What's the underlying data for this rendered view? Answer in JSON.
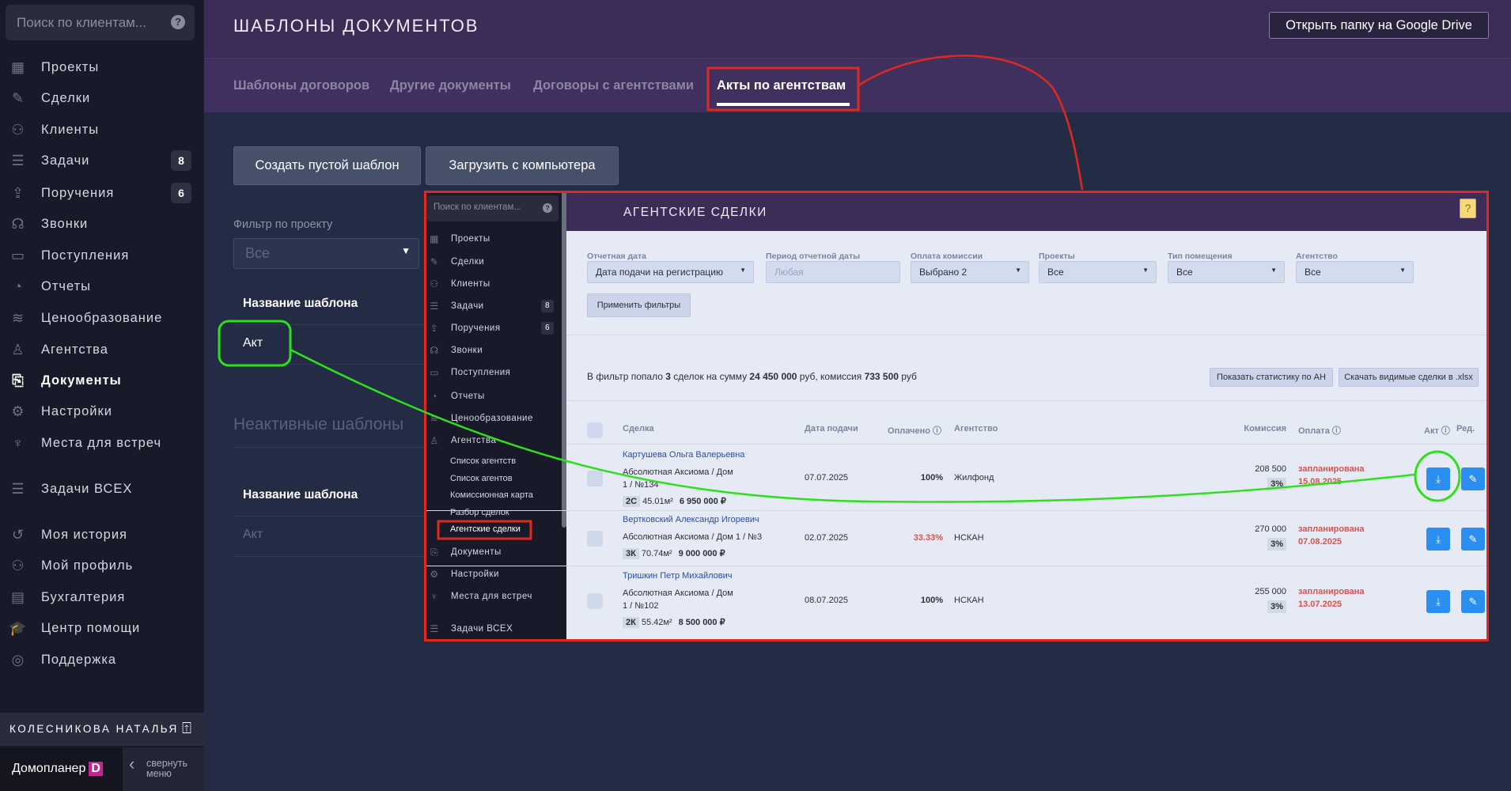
{
  "sidebar": {
    "search_placeholder": "Поиск по клиентам...",
    "items": [
      {
        "label": "Проекты",
        "icon": "building-icon",
        "glyph": "▦"
      },
      {
        "label": "Сделки",
        "icon": "deal-icon",
        "glyph": "✎"
      },
      {
        "label": "Клиенты",
        "icon": "users-icon",
        "glyph": "⚇"
      },
      {
        "label": "Задачи",
        "icon": "tasks-icon",
        "glyph": "☰",
        "badge": "8"
      },
      {
        "label": "Поручения",
        "icon": "inbox-upload-icon",
        "glyph": "⇪",
        "badge": "6"
      },
      {
        "label": "Звонки",
        "icon": "headset-icon",
        "glyph": "☊"
      },
      {
        "label": "Поступления",
        "icon": "wallet-icon",
        "glyph": "▭"
      },
      {
        "label": "Отчеты",
        "icon": "pie-chart-icon",
        "glyph": "◔"
      },
      {
        "label": "Ценообразование",
        "icon": "coins-icon",
        "glyph": "≋"
      },
      {
        "label": "Агентства",
        "icon": "agent-icon",
        "glyph": "♙"
      },
      {
        "label": "Документы",
        "icon": "documents-icon",
        "glyph": "⎘",
        "active": true
      },
      {
        "label": "Настройки",
        "icon": "gear-icon",
        "glyph": "⚙"
      },
      {
        "label": "Места для встреч",
        "icon": "microphone-icon",
        "glyph": "♆"
      },
      {
        "label": "Задачи ВСЕХ",
        "icon": "tasks-icon",
        "glyph": "☰"
      },
      {
        "label": "Моя история",
        "icon": "history-icon",
        "glyph": "↺"
      },
      {
        "label": "Мой профиль",
        "icon": "user-settings-icon",
        "glyph": "⚇"
      },
      {
        "label": "Бухгалтерия",
        "icon": "accounting-icon",
        "glyph": "▤"
      },
      {
        "label": "Центр помощи",
        "icon": "graduation-cap-icon",
        "glyph": "🎓"
      },
      {
        "label": "Поддержка",
        "icon": "lifebuoy-icon",
        "glyph": "◎"
      }
    ],
    "user_name": "КОЛЕСНИКОВА НАТАЛЬЯ",
    "brand": "Домопланер",
    "brand_logo": "D",
    "collapse_label_1": "свернуть",
    "collapse_label_2": "меню"
  },
  "header": {
    "title": "ШАБЛОНЫ ДОКУМЕНТОВ",
    "gdrive_button": "Открыть папку на Google Drive",
    "tabs": [
      {
        "label": "Шаблоны договоров"
      },
      {
        "label": "Другие документы"
      },
      {
        "label": "Договоры с агентствами"
      },
      {
        "label": "Акты по агентствам",
        "active": true
      }
    ]
  },
  "main": {
    "create_button": "Создать пустой шаблон",
    "upload_button": "Загрузить с компьютера",
    "filter_label": "Фильтр по проекту",
    "filter_value": "Все",
    "active_header": "Название шаблона",
    "active_templates": [
      "Акт"
    ],
    "inactive_title": "Неактивные шаблоны",
    "inactive_header": "Название шаблона",
    "inactive_templates": [
      "Акт"
    ]
  },
  "inner": {
    "search_placeholder": "Поиск по клиентам...",
    "nav": [
      {
        "label": "Проекты",
        "glyph": "▦",
        "icon": "building-icon"
      },
      {
        "label": "Сделки",
        "glyph": "✎",
        "icon": "deal-icon"
      },
      {
        "label": "Клиенты",
        "glyph": "⚇",
        "icon": "users-icon"
      },
      {
        "label": "Задачи",
        "glyph": "☰",
        "icon": "tasks-icon",
        "badge": "8"
      },
      {
        "label": "Поручения",
        "glyph": "⇪",
        "icon": "inbox-upload-icon",
        "badge": "6"
      },
      {
        "label": "Звонки",
        "glyph": "☊",
        "icon": "headset-icon"
      },
      {
        "label": "Поступления",
        "glyph": "▭",
        "icon": "wallet-icon"
      },
      {
        "label": "Отчеты",
        "glyph": "◔",
        "icon": "pie-chart-icon"
      },
      {
        "label": "Ценообразование",
        "glyph": "≋",
        "icon": "coins-icon"
      },
      {
        "label": "Агентства",
        "glyph": "♙",
        "icon": "agent-icon"
      },
      {
        "label": "Список агентств",
        "sub": true
      },
      {
        "label": "Список агентов",
        "sub": true
      },
      {
        "label": "Комиссионная карта",
        "sub": true
      },
      {
        "label": "Разбор сделок",
        "sub": true
      },
      {
        "label": "Агентские сделки",
        "sub": true,
        "active": true
      },
      {
        "label": "Документы",
        "glyph": "⎘",
        "icon": "documents-icon"
      },
      {
        "label": "Настройки",
        "glyph": "⚙",
        "icon": "gear-icon"
      },
      {
        "label": "Места для встреч",
        "glyph": "♆",
        "icon": "microphone-icon"
      },
      {
        "label": "Задачи ВСЕХ",
        "glyph": "☰",
        "icon": "tasks-icon"
      }
    ],
    "title": "АГЕНТСКИЕ СДЕЛКИ",
    "filters": [
      {
        "label": "Отчетная дата",
        "value": "Дата подачи на регистрацию",
        "dropdown": true
      },
      {
        "label": "Период отчетной даты",
        "value": "Любая",
        "placeholder": true
      },
      {
        "label": "Оплата комиссии",
        "value": "Выбрано 2",
        "dropdown": true
      },
      {
        "label": "Проекты",
        "value": "Все",
        "dropdown": true
      },
      {
        "label": "Тип помещения",
        "value": "Все",
        "dropdown": true
      },
      {
        "label": "Агентство",
        "value": "Все",
        "dropdown": true
      }
    ],
    "apply_button": "Применить фильтры",
    "summary": {
      "pre": "В фильтр попало ",
      "count": "3",
      "mid1": " сделок на сумму ",
      "sum": "24 450 000",
      "mid2": " руб, комиссия ",
      "commission": "733 500",
      "post": " руб"
    },
    "stats_button": "Показать статистику по АН",
    "download_button": "Скачать видимые сделки в .xlsx",
    "columns": {
      "deal": "Сделка",
      "date": "Дата подачи",
      "paid": "Оплачено ⓘ",
      "agency": "Агентство",
      "commission": "Комиссия",
      "payment": "Оплата ⓘ",
      "act": "Акт ⓘ",
      "edit": "Ред."
    },
    "rows": [
      {
        "client": "Картушева Ольга Валерьевна",
        "addr1": "Абсолютная Аксиома  /  Дом",
        "addr2": "1  /  №134",
        "type": "2С",
        "area": "45.01м²",
        "price": "6 950 000 ₽",
        "date": "07.07.2025",
        "paid": "100%",
        "paid_warn": false,
        "agency": "Жилфонд",
        "commission": "208 500",
        "pct": "3%",
        "status": "запланирована",
        "pay_date": "15.08.2025"
      },
      {
        "client": "Вертковский Александр Игоревич",
        "addr1": "Абсолютная Аксиома  /  Дом 1  /  №3",
        "addr2": "",
        "type": "3К",
        "area": "70.74м²",
        "price": "9 000 000 ₽",
        "date": "02.07.2025",
        "paid": "33.33%",
        "paid_warn": true,
        "agency": "НСКАН",
        "commission": "270 000",
        "pct": "3%",
        "status": "запланирована",
        "pay_date": "07.08.2025"
      },
      {
        "client": "Тришкин Петр Михайлович",
        "addr1": "Абсолютная Аксиома  /  Дом",
        "addr2": "1  /  №102",
        "type": "2К",
        "area": "55.42м²",
        "price": "8 500 000 ₽",
        "date": "08.07.2025",
        "paid": "100%",
        "paid_warn": false,
        "agency": "НСКАН",
        "commission": "255 000",
        "pct": "3%",
        "status": "запланирована",
        "pay_date": "13.07.2025"
      }
    ]
  },
  "colors": {
    "annotation_red": "#e0291c",
    "annotation_green": "#2ee01c",
    "accent_blue": "#2a8ff0",
    "header_purple": "#3b2d58",
    "warning_red": "#d9534f"
  }
}
